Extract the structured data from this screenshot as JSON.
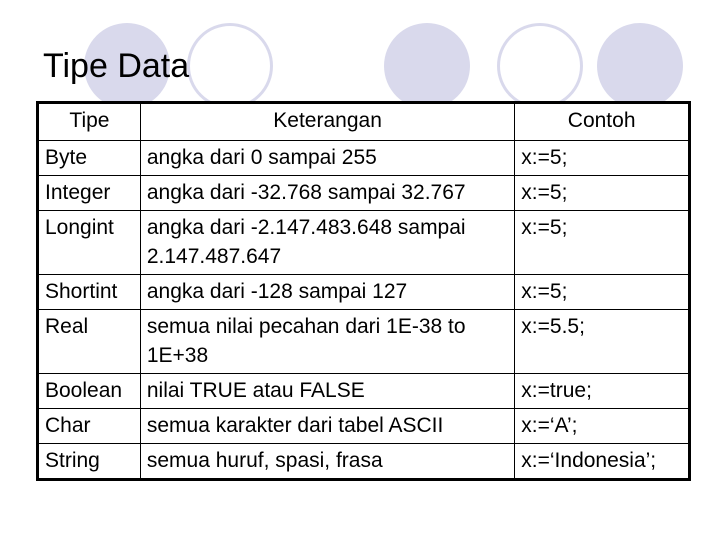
{
  "title": "Tipe Data",
  "decoration": {
    "circle_color": "#d9d9ec",
    "circles": [
      "filled",
      "outline",
      "filled",
      "outline",
      "filled"
    ]
  },
  "table": {
    "headers": [
      "Tipe",
      "Keterangan",
      "Contoh"
    ],
    "rows": [
      {
        "tipe": "Byte",
        "keterangan": "angka dari 0 sampai 255",
        "contoh": "x:=5;"
      },
      {
        "tipe": "Integer",
        "keterangan": "angka dari -32.768 sampai 32.767",
        "contoh": "x:=5;"
      },
      {
        "tipe": "Longint",
        "keterangan": "angka dari -2.147.483.648 sampai 2.147.487.647",
        "contoh": "x:=5;"
      },
      {
        "tipe": "Shortint",
        "keterangan": "angka dari -128 sampai 127",
        "contoh": "x:=5;"
      },
      {
        "tipe": "Real",
        "keterangan": "semua nilai pecahan dari 1E-38 to 1E+38",
        "contoh": "x:=5.5;"
      },
      {
        "tipe": "Boolean",
        "keterangan": "nilai TRUE atau FALSE",
        "contoh": "x:=true;"
      },
      {
        "tipe": "Char",
        "keterangan": "semua karakter dari tabel ASCII",
        "contoh": "x:=‘A’;"
      },
      {
        "tipe": "String",
        "keterangan": "semua huruf, spasi, frasa",
        "contoh": "x:=‘Indonesia’;"
      }
    ]
  }
}
